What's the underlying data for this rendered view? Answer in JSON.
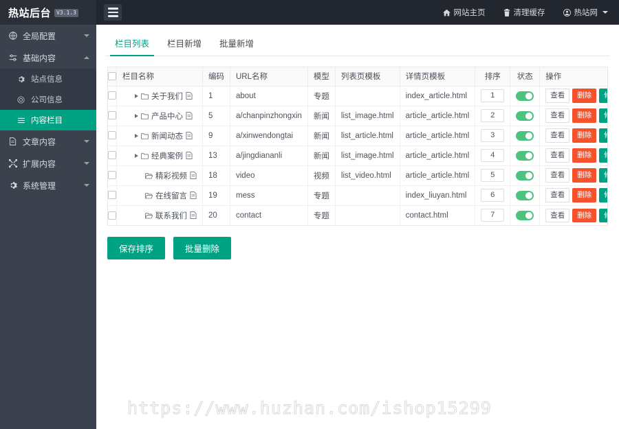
{
  "brand": {
    "title": "热站后台",
    "version": "V3.1.3"
  },
  "topnav": [
    {
      "label": "网站主页",
      "icon": "home-icon"
    },
    {
      "label": "清理缓存",
      "icon": "trash-icon"
    },
    {
      "label": "热站网",
      "icon": "user-circle-icon",
      "has_caret": true
    }
  ],
  "sidebar": {
    "groups": [
      {
        "label": "全局配置",
        "icon": "globe-icon",
        "expanded": false
      },
      {
        "label": "基础内容",
        "icon": "sliders-icon",
        "expanded": true,
        "items": [
          {
            "label": "站点信息",
            "icon": "gear-icon",
            "active": false
          },
          {
            "label": "公司信息",
            "icon": "circle-dot-icon",
            "active": false
          },
          {
            "label": "内容栏目",
            "icon": "list-icon",
            "active": true
          }
        ]
      },
      {
        "label": "文章内容",
        "icon": "document-icon",
        "expanded": false
      },
      {
        "label": "扩展内容",
        "icon": "expand-icon",
        "expanded": false
      },
      {
        "label": "系统管理",
        "icon": "gear-icon",
        "expanded": false
      }
    ]
  },
  "tabs": [
    {
      "label": "栏目列表",
      "active": true
    },
    {
      "label": "栏目新增",
      "active": false
    },
    {
      "label": "批量新增",
      "active": false
    }
  ],
  "table": {
    "headers": [
      "",
      "栏目名称",
      "编码",
      "URL名称",
      "模型",
      "列表页模板",
      "详情页模板",
      "排序",
      "状态",
      "操作"
    ],
    "rows": [
      {
        "name": "关于我们",
        "code": "1",
        "url": "about",
        "model": "专题",
        "list_tpl": "",
        "detail_tpl": "index_article.html",
        "sort": "1",
        "state_on": true,
        "expandable": true
      },
      {
        "name": "产品中心",
        "code": "5",
        "url": "a/chanpinzhongxin",
        "model": "新闻",
        "list_tpl": "list_image.html",
        "detail_tpl": "article_article.html",
        "sort": "2",
        "state_on": true,
        "expandable": true
      },
      {
        "name": "新闻动态",
        "code": "9",
        "url": "a/xinwendongtai",
        "model": "新闻",
        "list_tpl": "list_article.html",
        "detail_tpl": "article_article.html",
        "sort": "3",
        "state_on": true,
        "expandable": true
      },
      {
        "name": "经典案例",
        "code": "13",
        "url": "a/jingdiananli",
        "model": "新闻",
        "list_tpl": "list_image.html",
        "detail_tpl": "article_article.html",
        "sort": "4",
        "state_on": true,
        "expandable": true
      },
      {
        "name": "精彩视频",
        "code": "18",
        "url": "video",
        "model": "视频",
        "list_tpl": "list_video.html",
        "detail_tpl": "article_article.html",
        "sort": "5",
        "state_on": true,
        "expandable": false
      },
      {
        "name": "在线留言",
        "code": "19",
        "url": "mess",
        "model": "专题",
        "list_tpl": "",
        "detail_tpl": "index_liuyan.html",
        "sort": "6",
        "state_on": true,
        "expandable": false
      },
      {
        "name": "联系我们",
        "code": "20",
        "url": "contact",
        "model": "专题",
        "list_tpl": "",
        "detail_tpl": "contact.html",
        "sort": "7",
        "state_on": true,
        "expandable": false
      }
    ],
    "row_actions": {
      "view": "查看",
      "delete": "删除",
      "edit": "修改"
    }
  },
  "footer_buttons": [
    {
      "label": "保存排序",
      "name": "save-sort-button"
    },
    {
      "label": "批量删除",
      "name": "batch-delete-button"
    }
  ],
  "watermark": "https://www.huzhan.com/ishop15299",
  "colors": {
    "accent": "#00a284",
    "danger": "#f4512c",
    "toggle_on": "#4cc37e",
    "sidebar": "#3b414d",
    "topbar": "#22262e"
  }
}
